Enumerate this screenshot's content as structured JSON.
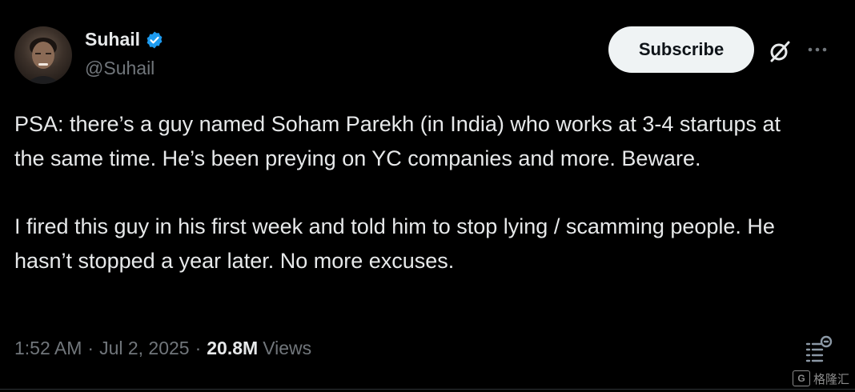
{
  "author": {
    "name": "Suhail",
    "handle": "@Suhail",
    "verified": true
  },
  "actions": {
    "subscribe_label": "Subscribe"
  },
  "tweet": {
    "paragraph1": "PSA: there’s a guy named Soham Parekh (in India) who works at 3-4 startups at the same time. He’s been preying on YC companies and more. Beware.",
    "paragraph2": "I fired this guy in his first week and told him to stop lying / scamming people. He hasn’t stopped a year later. No more excuses."
  },
  "meta": {
    "time": "1:52 AM",
    "separator": "·",
    "date": "Jul 2, 2025",
    "views_count": "20.8M",
    "views_label": "Views"
  },
  "watermark": {
    "logo": "G",
    "text": "格隆汇"
  },
  "colors": {
    "background": "#000000",
    "text": "#e7e9ea",
    "muted": "#71767b",
    "verified": "#1d9bf0",
    "button_bg": "#eff3f4"
  },
  "icons": [
    "verified-badge-icon",
    "grok-icon",
    "more-options-icon",
    "post-analytics-icon"
  ]
}
